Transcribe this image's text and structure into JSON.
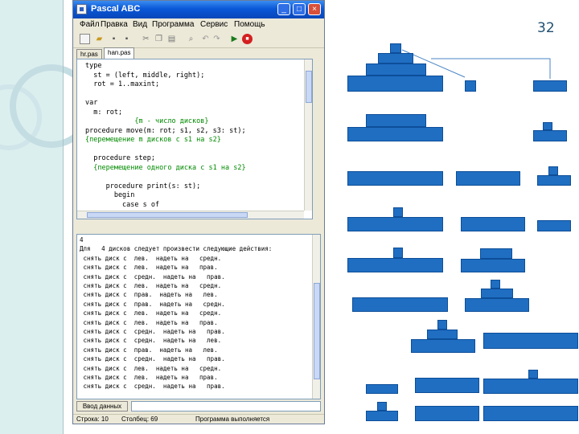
{
  "slide": {
    "number": "32"
  },
  "window": {
    "title": "Pascal ABC",
    "controls": {
      "minimize": "_",
      "maximize": "□",
      "close": "×"
    }
  },
  "menu": [
    "Файл",
    "Правка",
    "Вид",
    "Программа",
    "Сервис",
    "Помощь"
  ],
  "tabs": [
    "hr.pas",
    "han.pas"
  ],
  "editor": {
    "lines": [
      {
        "text": "type",
        "kind": "code",
        "indent": 0
      },
      {
        "text": "  st = (left, middle, right);",
        "kind": "code",
        "indent": 0
      },
      {
        "text": "  rot = 1..maxint;",
        "kind": "code",
        "indent": 0
      },
      {
        "text": "",
        "kind": "code",
        "indent": 0
      },
      {
        "text": "var",
        "kind": "code",
        "indent": 0
      },
      {
        "text": "  m: rot;",
        "kind": "code",
        "indent": 0
      },
      {
        "text": "            {m - число дисков}",
        "kind": "comment",
        "indent": 0
      },
      {
        "text": "procedure move(m: rot; s1, s2, s3: st);",
        "kind": "code",
        "indent": 0
      },
      {
        "text": "{перемещение m дисков с s1 на s2}",
        "kind": "comment",
        "indent": 0
      },
      {
        "text": "",
        "kind": "code",
        "indent": 0
      },
      {
        "text": "  procedure step;",
        "kind": "code",
        "indent": 0
      },
      {
        "text": "  {перемещение одного диска с s1 на s2}",
        "kind": "comment",
        "indent": 0
      },
      {
        "text": "",
        "kind": "code",
        "indent": 0
      },
      {
        "text": "     procedure print(s: st);",
        "kind": "code",
        "indent": 0
      },
      {
        "text": "       begin",
        "kind": "code",
        "indent": 0
      },
      {
        "text": "         case s of",
        "kind": "code",
        "indent": 0
      }
    ]
  },
  "output": {
    "lines": [
      "4",
      "Для   4 дисков следует произвести следующие действия:",
      " снять диск с  лев.  надеть на   средн.",
      " снять диск с  лев.  надеть на   прав.",
      " снять диск с  средн.  надеть на   прав.",
      " снять диск с  лев.  надеть на   средн.",
      " снять диск с  прав.  надеть на   лев.",
      " снять диск с  прав.  надеть на   средн.",
      " снять диск с  лев.  надеть на   средн.",
      " снять диск с  лев.  надеть на   прав.",
      " снять диск с  средн.  надеть на   прав.",
      " снять диск с  средн.  надеть на   лев.",
      " снять диск с  прав.  надеть на   лев.",
      " снять диск с  средн.  надеть на   прав.",
      " снять диск с  лев.  надеть на   средн.",
      " снять диск с  лев.  надеть на   прав.",
      " снять диск с  средн.  надеть на   прав."
    ]
  },
  "input": {
    "button_label": "Ввод данных"
  },
  "status": {
    "line": "Строка: 10",
    "column": "Столбец: 69",
    "state": "Программа выполняется"
  },
  "colors": {
    "disk": "#1f6ec2",
    "title_bar": "#0a58d8",
    "comment": "#008a00"
  }
}
